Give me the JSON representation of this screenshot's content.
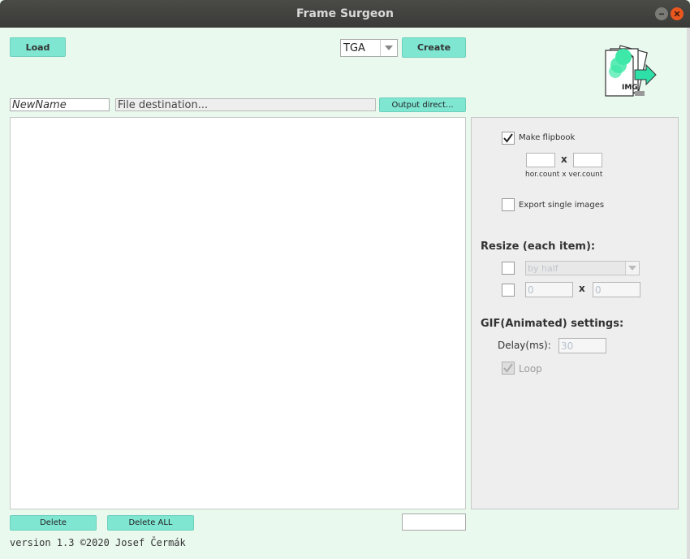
{
  "window": {
    "title": "Frame Surgeon"
  },
  "toolbar": {
    "load_label": "Load",
    "format_selected": "TGA",
    "create_label": "Create"
  },
  "fields": {
    "name_value": "NewName",
    "destination_value": "File destination...",
    "output_dir_label": "Output direct..."
  },
  "flipbook": {
    "make_flipbook_label": "Make flipbook",
    "make_flipbook_checked": true,
    "hor_count_value": "",
    "ver_count_value": "",
    "x_separator": "x",
    "count_caption": "hor.count x ver.count",
    "export_single_label": "Export single images",
    "export_single_checked": false
  },
  "resize": {
    "heading": "Resize (each item):",
    "mode_selected": "by half",
    "width_value": "0",
    "height_value": "0",
    "x_separator": "x"
  },
  "gif": {
    "heading": "GIF(Animated) settings:",
    "delay_label": "Delay(ms):",
    "delay_value": "30",
    "loop_label": "Loop",
    "loop_checked": true
  },
  "bottom": {
    "delete_label": "Delete",
    "delete_all_label": "Delete ALL",
    "status_value": "",
    "version_text": "version 1.3 ©2020 Josef Čermák"
  },
  "logo": {
    "text": "IMG"
  },
  "colors": {
    "background": "#eaf9ee",
    "accent_button": "#7fe6d2",
    "titlebar": "#3f3f3d",
    "close_button": "#e9571f"
  },
  "icons": [
    "minimize-icon",
    "close-icon",
    "dropdown-arrow-icon",
    "check-icon",
    "app-logo-icon"
  ]
}
